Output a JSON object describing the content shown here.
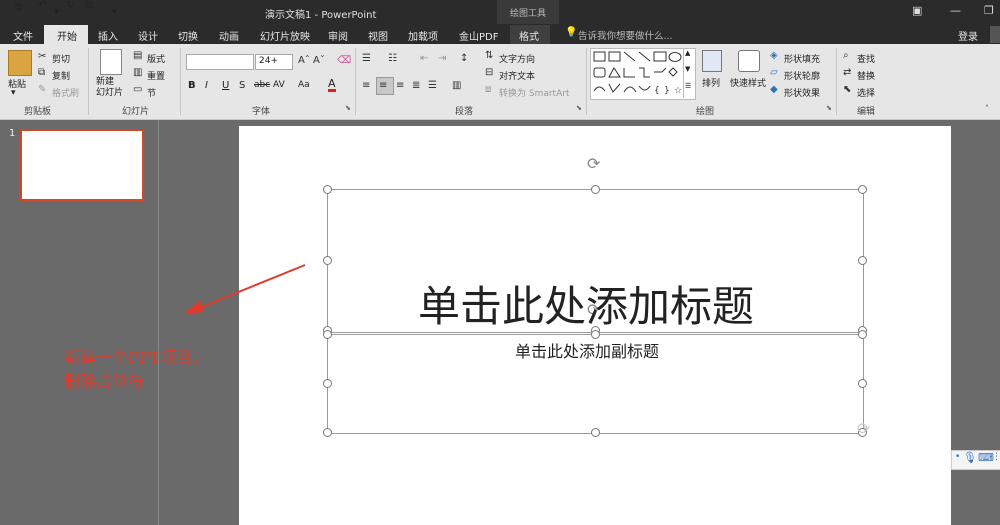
{
  "titlebar": {
    "quick_access": [
      "save-icon",
      "undo-icon",
      "redo-icon",
      "present-icon",
      "customize-icon"
    ],
    "doc_title": "演示文稿1 - PowerPoint",
    "contextual_tools": "绘图工具"
  },
  "tabs": [
    "文件",
    "开始",
    "插入",
    "设计",
    "切换",
    "动画",
    "幻灯片放映",
    "审阅",
    "视图",
    "加载项",
    "金山PDF",
    "格式"
  ],
  "tell_me": "告诉我你想要做什么...",
  "login": "登录",
  "ribbon": {
    "clipboard": {
      "label": "剪贴板",
      "paste": "粘贴",
      "cut": "剪切",
      "copy": "复制",
      "format_painter": "格式刷"
    },
    "slides": {
      "label": "幻灯片",
      "new_slide": "新建\n幻灯片",
      "layout": "版式",
      "reset": "重置",
      "section": "节"
    },
    "font": {
      "label": "字体",
      "size": "24+",
      "bold": "B",
      "italic": "I",
      "underline": "U",
      "shadow": "S",
      "strike": "abc",
      "spacing": "AV",
      "case": "Aa",
      "color": "A"
    },
    "paragraph": {
      "label": "段落",
      "text_direction": "文字方向",
      "align_text": "对齐文本",
      "smartart": "转换为 SmartArt"
    },
    "drawing": {
      "label": "绘图",
      "arrange": "排列",
      "quick_styles": "快速样式",
      "shape_fill": "形状填充",
      "shape_outline": "形状轮廓",
      "shape_effects": "形状效果"
    },
    "editing": {
      "label": "编辑",
      "find": "查找",
      "replace": "替换",
      "select": "选择"
    }
  },
  "colors": {
    "accent": "#d24726",
    "titlebar": "#2b2b2b",
    "ribbon": "#e6e6e6",
    "annotation": "#e23a2a"
  },
  "thumbnails": {
    "slide_number": "1"
  },
  "slide": {
    "title_placeholder": "单击此处添加标题",
    "subtitle_placeholder": "单击此处添加副标题"
  },
  "annotation": "新建一个PPT项目，\n删除占位符"
}
